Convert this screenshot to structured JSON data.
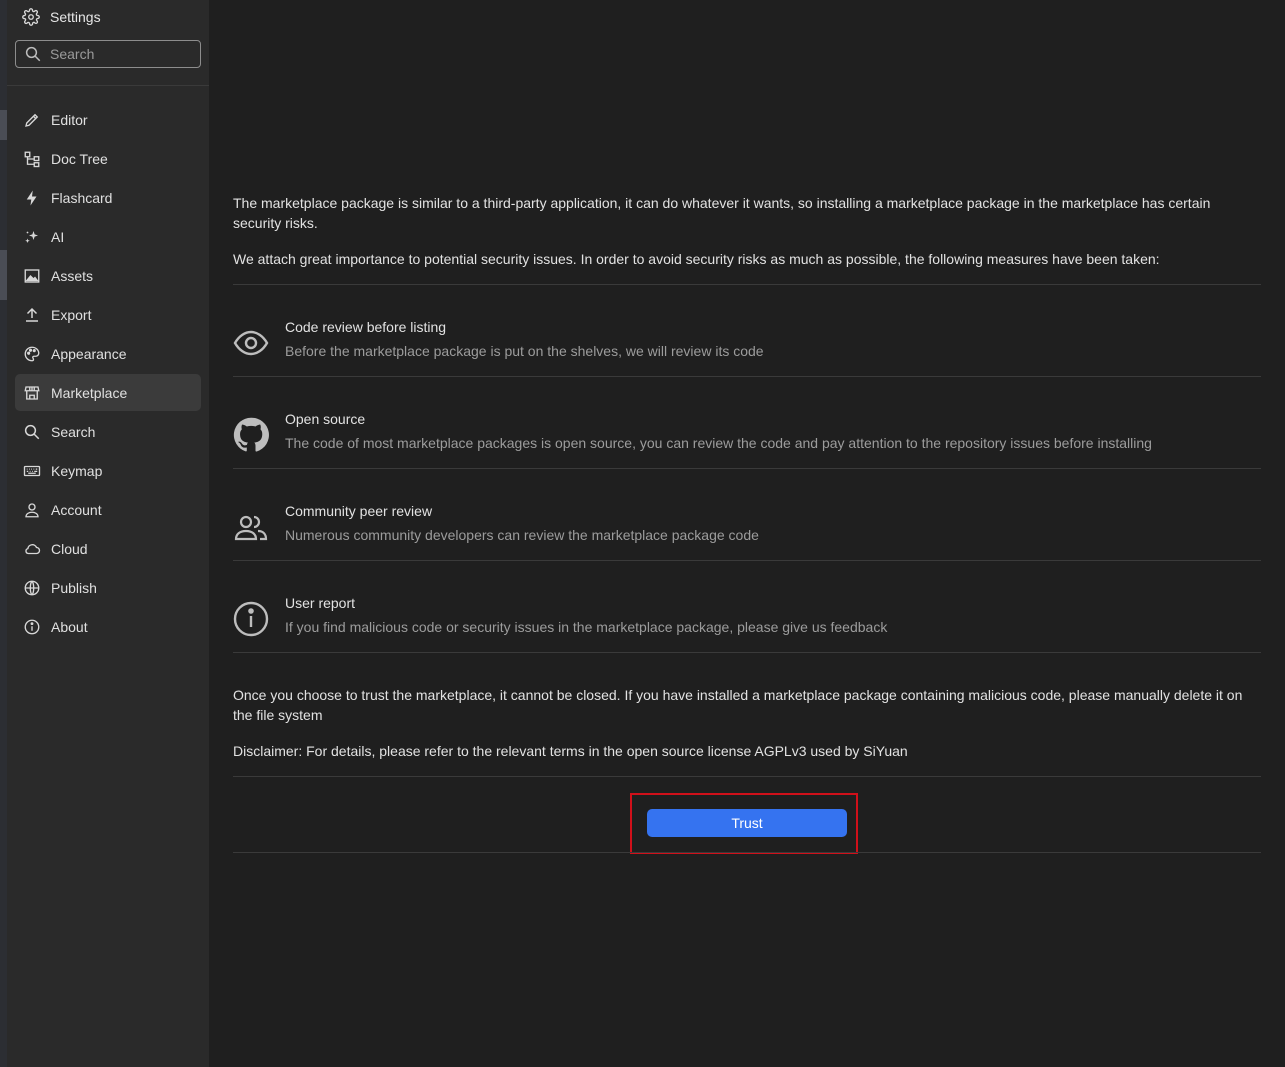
{
  "sidebar": {
    "header_title": "Settings",
    "search_placeholder": "Search",
    "items": [
      {
        "label": "Editor",
        "icon": "pencil-icon"
      },
      {
        "label": "Doc Tree",
        "icon": "tree-icon"
      },
      {
        "label": "Flashcard",
        "icon": "lightning-icon"
      },
      {
        "label": "AI",
        "icon": "sparkle-icon"
      },
      {
        "label": "Assets",
        "icon": "image-icon"
      },
      {
        "label": "Export",
        "icon": "upload-icon"
      },
      {
        "label": "Appearance",
        "icon": "palette-icon"
      },
      {
        "label": "Marketplace",
        "icon": "store-icon",
        "active": true
      },
      {
        "label": "Search",
        "icon": "search-icon"
      },
      {
        "label": "Keymap",
        "icon": "keyboard-icon"
      },
      {
        "label": "Account",
        "icon": "user-icon"
      },
      {
        "label": "Cloud",
        "icon": "cloud-icon"
      },
      {
        "label": "Publish",
        "icon": "globe-icon"
      },
      {
        "label": "About",
        "icon": "info-icon"
      }
    ]
  },
  "main": {
    "intro_1": "The marketplace package is similar to a third-party application, it can do whatever it wants, so installing a marketplace package in the marketplace has certain security risks.",
    "intro_2": "We attach great importance to potential security issues. In order to avoid security risks as much as possible, the following measures have been taken:",
    "features": [
      {
        "title": "Code review before listing",
        "desc": "Before the marketplace package is put on the shelves, we will review its code",
        "icon": "eye-icon"
      },
      {
        "title": "Open source",
        "desc": "The code of most marketplace packages is open source, you can review the code and pay attention to the repository issues before installing",
        "icon": "github-icon"
      },
      {
        "title": "Community peer review",
        "desc": "Numerous community developers can review the marketplace package code",
        "icon": "people-icon"
      },
      {
        "title": "User report",
        "desc": "If you find malicious code or security issues in the marketplace package, please give us feedback",
        "icon": "info-circle-icon"
      }
    ],
    "warning": "Once you choose to trust the marketplace, it cannot be closed. If you have installed a marketplace package containing malicious code, please manually delete it on the file system",
    "disclaimer": "Disclaimer: For details, please refer to the relevant terms in the open source license AGPLv3 used by SiYuan",
    "trust_label": "Trust"
  },
  "colors": {
    "background": "#1f1f1f",
    "sidebar": "#2a2a2a",
    "accent": "#3573f0",
    "highlight": "#d0101a"
  }
}
